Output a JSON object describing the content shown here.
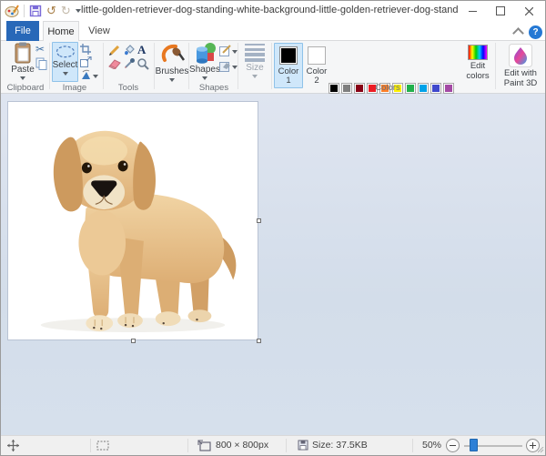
{
  "window": {
    "title": "little-golden-retriever-dog-standing-white-background-little-golden-retriever-dog-standing-white-backgrou..."
  },
  "quick_access": {
    "undo_glyph": "↺",
    "redo_glyph": "↻"
  },
  "tabs": {
    "file": "File",
    "home": "Home",
    "view": "View"
  },
  "ribbon": {
    "help_glyph": "?",
    "clipboard": {
      "group_label": "Clipboard",
      "paste_label": "Paste",
      "cut_glyph": "✂"
    },
    "image": {
      "group_label": "Image",
      "select_label": "Select"
    },
    "tools": {
      "group_label": "Tools",
      "text_glyph": "A"
    },
    "brushes": {
      "button_label": "Brushes"
    },
    "shapes": {
      "group_label": "Shapes",
      "button_label": "Shapes"
    },
    "size": {
      "button_label": "Size"
    },
    "colors": {
      "group_label": "Colors",
      "color1_label": "Color 1",
      "color1_value": "#000000",
      "color2_label": "Color 2",
      "color2_value": "#FFFFFF",
      "edit_colors_label": "Edit colors",
      "paint3d_label": "Edit with Paint 3D",
      "palette_rows": [
        [
          "#000000",
          "#7F7F7F",
          "#880015",
          "#ED1C24",
          "#FF7F27",
          "#FFF200",
          "#22B14C",
          "#00A2E8",
          "#3F48CC",
          "#A349A4"
        ],
        [
          "#FFFFFF",
          "#C3C3C3",
          "#B97A57",
          "#FFAEC9",
          "#FFC90E",
          "#EFE4B0",
          "#B5E61D",
          "#99D9EA",
          "#7092BE",
          "#C8BFE7"
        ]
      ],
      "empty_slots": 10
    }
  },
  "canvas": {
    "subject": "little golden retriever puppy standing on white background"
  },
  "status_bar": {
    "canvas_size": "800 × 800px",
    "file_size": "Size: 37.5KB",
    "zoom_level": "50%"
  },
  "theme": {
    "file_tab_blue": "#2868b8",
    "selection_highlight": "#cfe7fa",
    "workspace_top": "#dfe5f0",
    "workspace_bottom": "#d3ddea"
  }
}
